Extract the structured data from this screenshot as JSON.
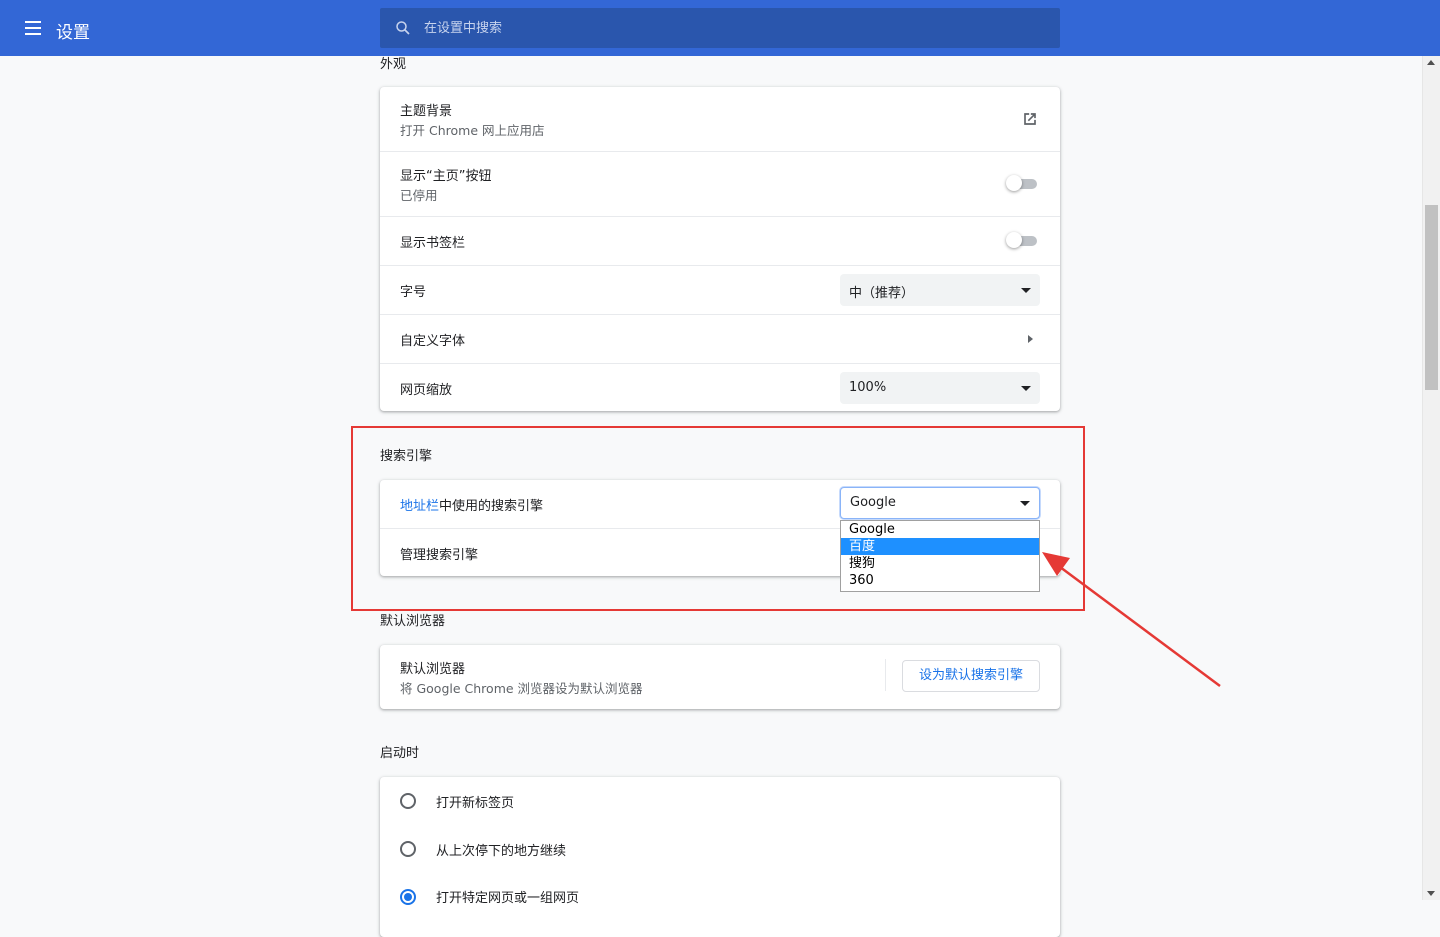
{
  "header": {
    "title": "设置",
    "search_placeholder": "在设置中搜索"
  },
  "appearance": {
    "section_title": "外观",
    "theme": {
      "label": "主题背景",
      "sub": "打开 Chrome 网上应用店"
    },
    "home_button": {
      "label": "显示“主页”按钮",
      "sub": "已停用",
      "enabled": false
    },
    "bookmarks_bar": {
      "label": "显示书签栏",
      "enabled": false
    },
    "font_size": {
      "label": "字号",
      "value": "中（推荐）"
    },
    "custom_fonts": {
      "label": "自定义字体"
    },
    "page_zoom": {
      "label": "网页缩放",
      "value": "100%"
    }
  },
  "search_engine": {
    "section_title": "搜索引擎",
    "address_bar_link": "地址栏",
    "address_bar_rest": "中使用的搜索引擎",
    "selected": "Google",
    "manage_label": "管理搜索引擎",
    "options": [
      "Google",
      "百度",
      "搜狗",
      "360"
    ],
    "highlighted_option": "百度"
  },
  "default_browser": {
    "section_title": "默认浏览器",
    "label": "默认浏览器",
    "sub": "将 Google Chrome 浏览器设为默认浏览器",
    "button": "设为默认搜索引擎"
  },
  "startup": {
    "section_title": "启动时",
    "options": [
      {
        "label": "打开新标签页",
        "checked": false
      },
      {
        "label": "从上次停下的地方继续",
        "checked": false
      },
      {
        "label": "打开特定网页或一组网页",
        "checked": true
      }
    ]
  },
  "colors": {
    "header": "#3367d6",
    "annotation": "#e53935",
    "dropdown_highlight": "#1e90ff",
    "link": "#1a73e8"
  }
}
